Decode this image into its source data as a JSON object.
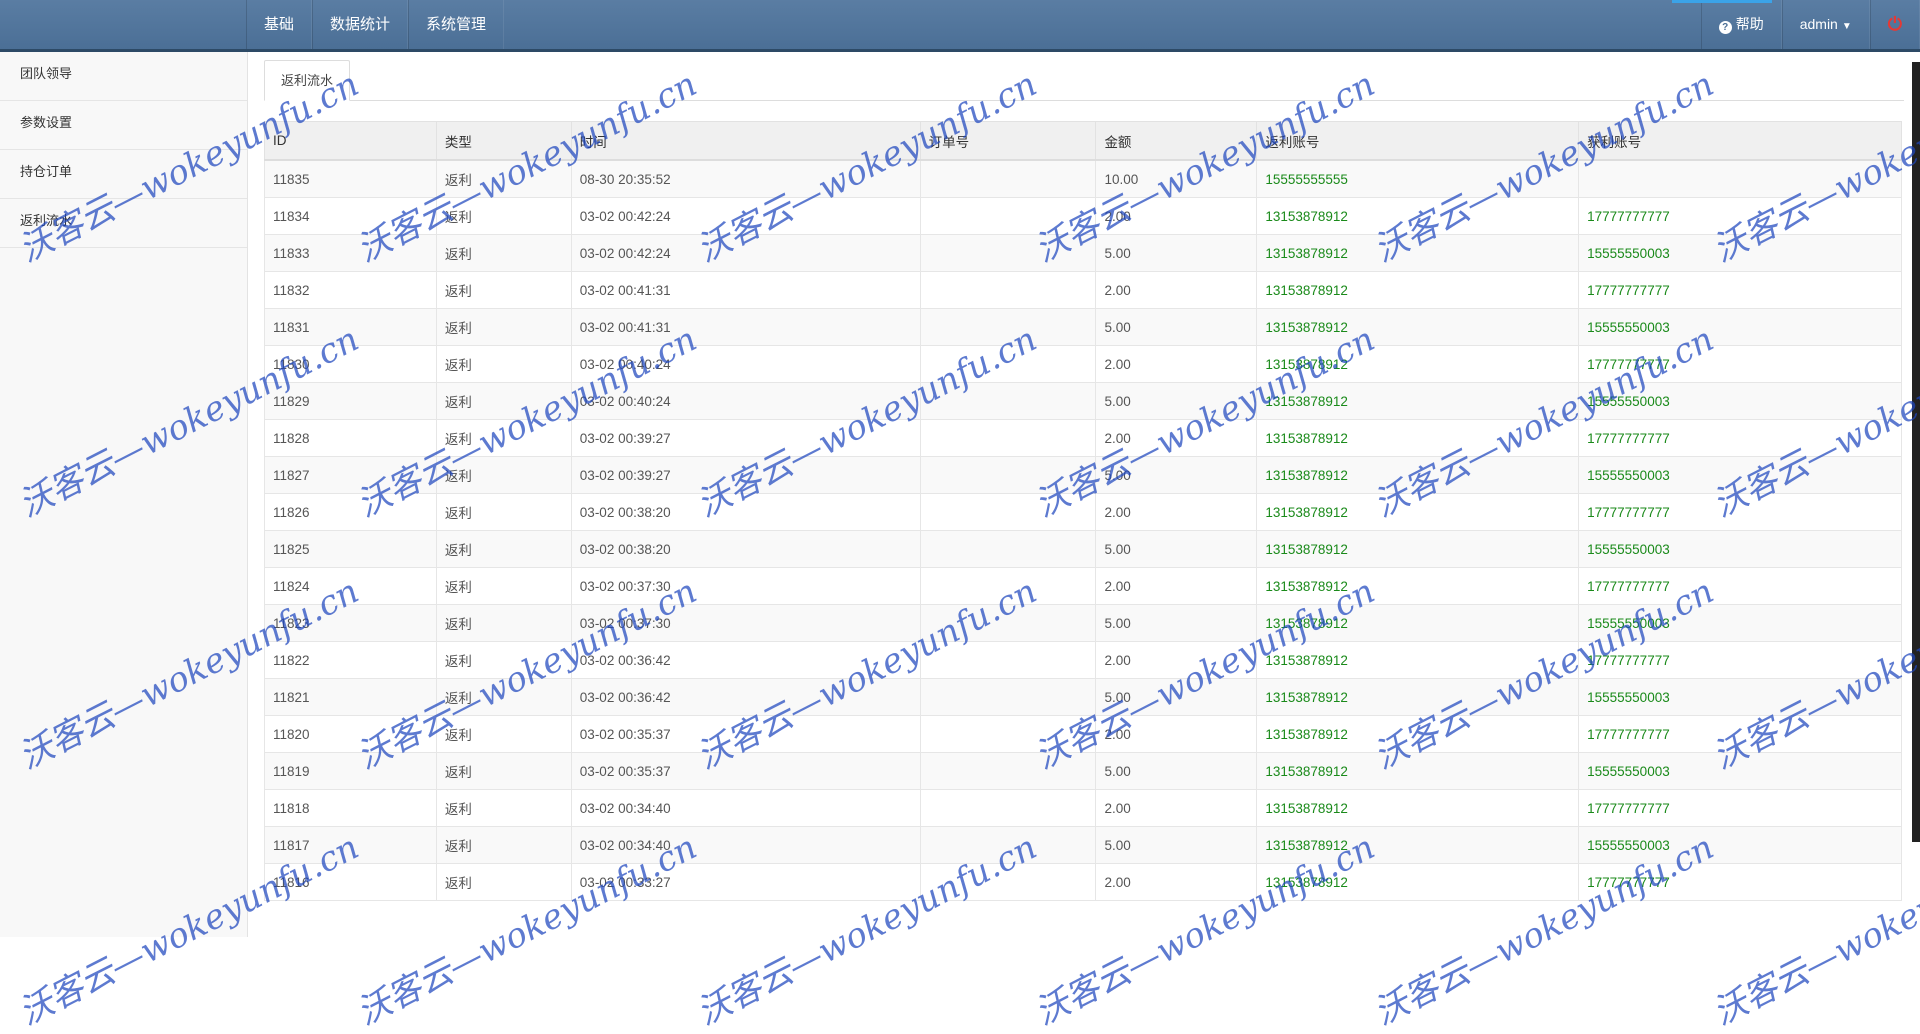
{
  "navbar": {
    "menu": [
      "基础",
      "数据统计",
      "系统管理"
    ],
    "help_label": "帮助",
    "user_label": "admin"
  },
  "sidebar": {
    "items": [
      "团队领导",
      "参数设置",
      "持仓订单",
      "返利流水"
    ]
  },
  "tabs": [
    "返利流水"
  ],
  "table": {
    "columns": [
      "ID",
      "类型",
      "时间",
      "订单号",
      "金额",
      "返利账号",
      "获利账号"
    ],
    "rows": [
      [
        "11835",
        "返利",
        "08-30 20:35:52",
        "",
        "10.00",
        "15555555555",
        ""
      ],
      [
        "11834",
        "返利",
        "03-02 00:42:24",
        "",
        "2.00",
        "13153878912",
        "17777777777"
      ],
      [
        "11833",
        "返利",
        "03-02 00:42:24",
        "",
        "5.00",
        "13153878912",
        "15555550003"
      ],
      [
        "11832",
        "返利",
        "03-02 00:41:31",
        "",
        "2.00",
        "13153878912",
        "17777777777"
      ],
      [
        "11831",
        "返利",
        "03-02 00:41:31",
        "",
        "5.00",
        "13153878912",
        "15555550003"
      ],
      [
        "11830",
        "返利",
        "03-02 00:40:24",
        "",
        "2.00",
        "13153878912",
        "17777777777"
      ],
      [
        "11829",
        "返利",
        "03-02 00:40:24",
        "",
        "5.00",
        "13153878912",
        "15555550003"
      ],
      [
        "11828",
        "返利",
        "03-02 00:39:27",
        "",
        "2.00",
        "13153878912",
        "17777777777"
      ],
      [
        "11827",
        "返利",
        "03-02 00:39:27",
        "",
        "5.00",
        "13153878912",
        "15555550003"
      ],
      [
        "11826",
        "返利",
        "03-02 00:38:20",
        "",
        "2.00",
        "13153878912",
        "17777777777"
      ],
      [
        "11825",
        "返利",
        "03-02 00:38:20",
        "",
        "5.00",
        "13153878912",
        "15555550003"
      ],
      [
        "11824",
        "返利",
        "03-02 00:37:30",
        "",
        "2.00",
        "13153878912",
        "17777777777"
      ],
      [
        "11823",
        "返利",
        "03-02 00:37:30",
        "",
        "5.00",
        "13153878912",
        "15555550003"
      ],
      [
        "11822",
        "返利",
        "03-02 00:36:42",
        "",
        "2.00",
        "13153878912",
        "17777777777"
      ],
      [
        "11821",
        "返利",
        "03-02 00:36:42",
        "",
        "5.00",
        "13153878912",
        "15555550003"
      ],
      [
        "11820",
        "返利",
        "03-02 00:35:37",
        "",
        "2.00",
        "13153878912",
        "17777777777"
      ],
      [
        "11819",
        "返利",
        "03-02 00:35:37",
        "",
        "5.00",
        "13153878912",
        "15555550003"
      ],
      [
        "11818",
        "返利",
        "03-02 00:34:40",
        "",
        "2.00",
        "13153878912",
        "17777777777"
      ],
      [
        "11817",
        "返利",
        "03-02 00:34:40",
        "",
        "5.00",
        "13153878912",
        "15555550003"
      ],
      [
        "11816",
        "返利",
        "03-02 00:33:27",
        "",
        "2.00",
        "13153878912",
        "17777777777"
      ]
    ]
  },
  "watermark": "沃客云—wokeyunfu.cn",
  "colors": {
    "navbar": "#4b6f96",
    "account_link": "#1a8a1a",
    "watermark": "#1e46be",
    "power": "#e53935"
  },
  "icons": {
    "help": "help-circle-icon",
    "caret": "caret-down-icon",
    "power": "power-icon"
  }
}
